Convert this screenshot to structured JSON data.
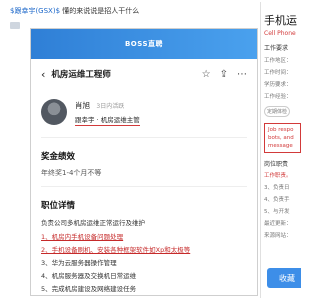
{
  "caption": {
    "user": "$跟幸宇(GSX)$",
    "text": "懂的来说说是招人干什么"
  },
  "banner": {
    "text": "BOSS直聘"
  },
  "header": {
    "back_icon": "chevron-left-icon",
    "title": "机房运维工程师",
    "icons": [
      "star-icon",
      "share-icon",
      "more-icon"
    ]
  },
  "profile": {
    "name": "肖旭",
    "sub": "3日内活跃",
    "role": "跟幸宇 · 机房运维主管"
  },
  "bonus": {
    "title": "奖金绩效",
    "text": "年终奖1-4个月不等"
  },
  "details": {
    "title": "职位详情",
    "lead": "负责公司多机房运维正常运行及维护",
    "tasks": [
      "1、机房内手机设备问题处理",
      "2、手机设备刷机、安装各种框架软件如Xp和太极等",
      "3、华为云服务器操作管理",
      "4、机房服务器及交换机日常运维",
      "5、完成机房建设及网络建设任务"
    ]
  },
  "right": {
    "title": "手机运",
    "sub": "Cell Phone",
    "req_label": "工作要求",
    "lines": [
      "工作地区：",
      "工作时间：",
      "学历要求：",
      "工作经验："
    ],
    "tag": "定期体检",
    "box": [
      "Job respo",
      "bots, and",
      "message"
    ],
    "duty_label": "岗位职责",
    "duty": [
      "工作职责。",
      "3、负责日",
      "4、负责手",
      "5、与开发"
    ],
    "lines2": [
      "最近更新：",
      "来源网站："
    ],
    "apply": "收藏"
  }
}
